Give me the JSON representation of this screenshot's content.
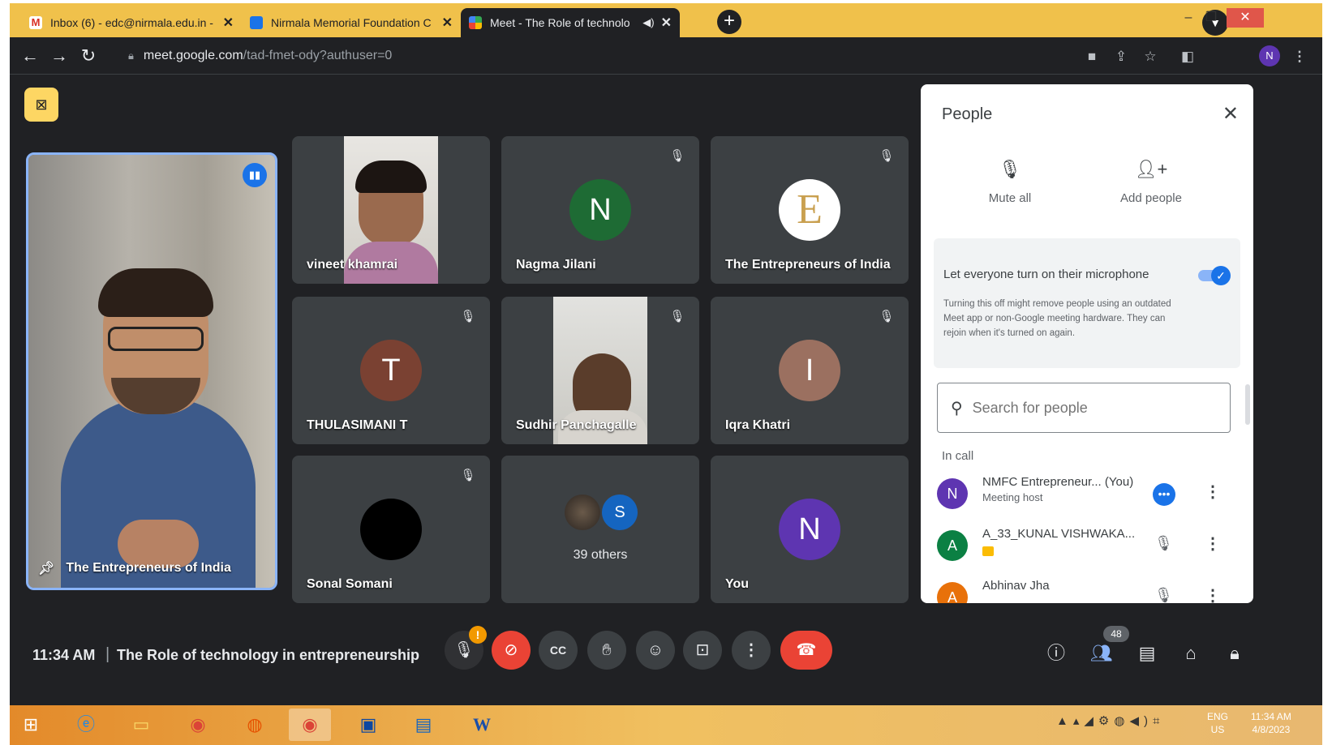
{
  "browser": {
    "tabs": [
      {
        "title": "Inbox (6) - edc@nirmala.edu.in -",
        "icon": "gmail-icon",
        "active": false
      },
      {
        "title": "Nirmala Memorial Foundation C",
        "icon": "document-icon",
        "active": false
      },
      {
        "title": "Meet - The Role of technolo",
        "icon": "meet-icon",
        "active": true
      }
    ],
    "url_host": "meet.google.com",
    "url_path": "/tad-fmet-ody?authuser=0",
    "profile_initial": "N"
  },
  "meet": {
    "pinned": {
      "name": "The Entrepreneurs of India"
    },
    "tiles": [
      {
        "name": "vineet khamrai",
        "kind": "video"
      },
      {
        "name": "Nagma Jilani",
        "initial": "N",
        "color": "#1e6b34"
      },
      {
        "name": "The Entrepreneurs of India",
        "initial": "E",
        "color": "#ffffff"
      },
      {
        "name": "THULASIMANI T",
        "initial": "T",
        "color": "#7a4132"
      },
      {
        "name": "Sudhir Panchagalle",
        "kind": "video"
      },
      {
        "name": "Iqra Khatri",
        "initial": "I",
        "color": "#9b7060"
      },
      {
        "name": "Sonal Somani",
        "color": "#000000"
      },
      {
        "name": "39 others",
        "initial": "S",
        "color": "#1565c0"
      },
      {
        "name": "You",
        "initial": "N",
        "color": "#5e35b1"
      }
    ],
    "time": "11:34 AM",
    "separator": "|",
    "title": "The Role of technology in entrepreneurship",
    "mic_alert": "!",
    "people_count": "48"
  },
  "people_panel": {
    "title": "People",
    "actions": {
      "mute_all": "Mute all",
      "add_people": "Add people"
    },
    "mic_setting": {
      "title": "Let everyone turn on their microphone",
      "enabled": true,
      "description": "Turning this off might remove people using an outdated Meet app or non-Google meeting hardware. They can rejoin when it's turned on again."
    },
    "search_placeholder": "Search for people",
    "in_call_label": "In call",
    "participants": [
      {
        "initial": "N",
        "name": "NMFC Entrepreneur... (You)",
        "sub": "Meeting host",
        "color": "#5e35b1"
      },
      {
        "initial": "A",
        "name": "A_33_KUNAL VISHWAKA...",
        "sub": "",
        "color": "#0b8043"
      },
      {
        "initial": "A",
        "name": "Abhinav Jha",
        "sub": "",
        "color": "#e8710a"
      }
    ]
  },
  "taskbar": {
    "lang_top": "ENG",
    "lang_bottom": "US",
    "time": "11:34 AM",
    "date": "4/8/2023"
  }
}
